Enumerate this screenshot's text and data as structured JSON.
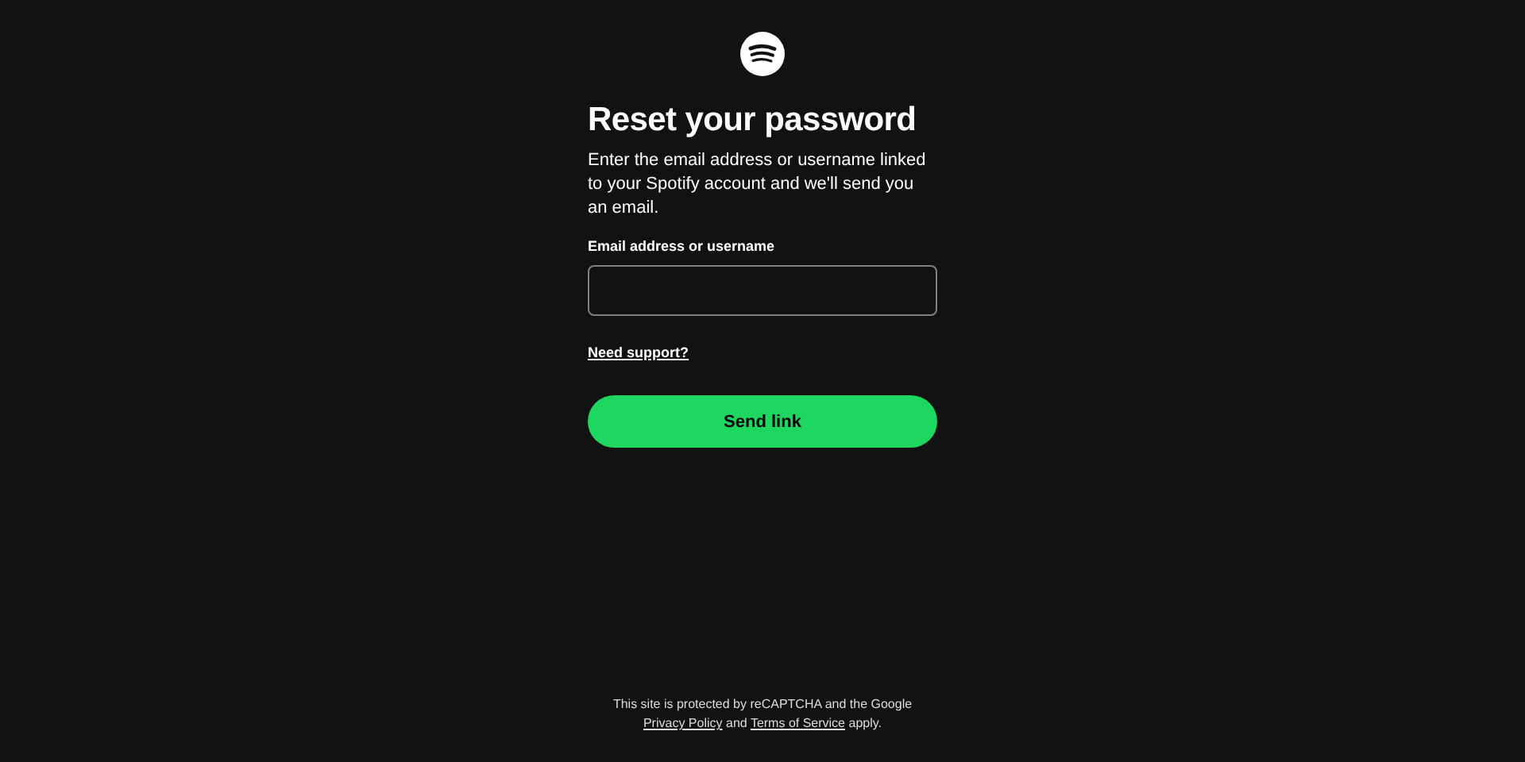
{
  "title": "Reset your password",
  "description": "Enter the email address or username linked to your Spotify account and we'll send you an email.",
  "email_field": {
    "label": "Email address or username"
  },
  "support_link": "Need support?",
  "send_button": "Send link",
  "footer": {
    "text_before": "This site is protected by reCAPTCHA and the Google",
    "privacy_link": "Privacy Policy",
    "text_middle": "and",
    "terms_link": "Terms of Service",
    "text_after": "apply."
  }
}
